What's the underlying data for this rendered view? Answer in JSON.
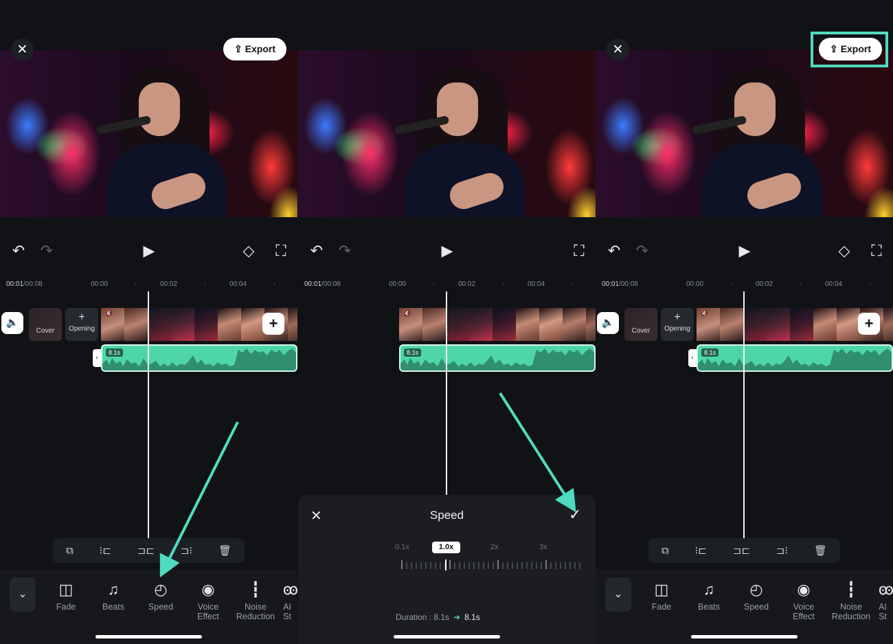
{
  "panels": [
    {
      "export_label": "Export",
      "time_current": "00:01",
      "time_total": "/00:08",
      "ruler": [
        "00:00",
        "00:02",
        "00:04"
      ],
      "cover_label": "Cover",
      "opening_label": "Opening",
      "audio_length": "8.1s",
      "tools": [
        "Fade",
        "Beats",
        "Speed",
        "Voice Effect",
        "Noise Reduction",
        "AI St"
      ]
    },
    {
      "time_current": "00:01",
      "time_total": "/00:08",
      "ruler": [
        "00:00",
        "00:02",
        "00:04"
      ],
      "audio_length": "8.1s",
      "speed_sheet": {
        "title": "Speed",
        "options": [
          "0.1x",
          "1.0x",
          "2x",
          "3x"
        ],
        "selected": "1.0x",
        "duration_label": "Duration : 8.1s",
        "duration_new": "8.1s"
      }
    },
    {
      "export_label": "Export",
      "time_current": "00:01",
      "time_total": "/00:08",
      "ruler": [
        "00:00",
        "00:02",
        "00:04"
      ],
      "cover_label": "Cover",
      "opening_label": "Opening",
      "audio_length": "8.1s",
      "tools": [
        "Fade",
        "Beats",
        "Speed",
        "Voice Effect",
        "Noise Reduction",
        "AI St"
      ]
    }
  ],
  "icons": {
    "close": "close-icon",
    "export": "upload-icon",
    "undo": "undo-icon",
    "redo": "redo-icon",
    "play": "play-icon",
    "keyframe": "keyframe-icon",
    "fullscreen": "fullscreen-icon",
    "volume": "volume-icon",
    "add": "plus-icon",
    "collapse": "chevron-down-icon",
    "confirm": "check-icon"
  },
  "colors": {
    "accent": "#4fdbbf",
    "audio_track": "#4fd6a8",
    "background": "#101216"
  }
}
